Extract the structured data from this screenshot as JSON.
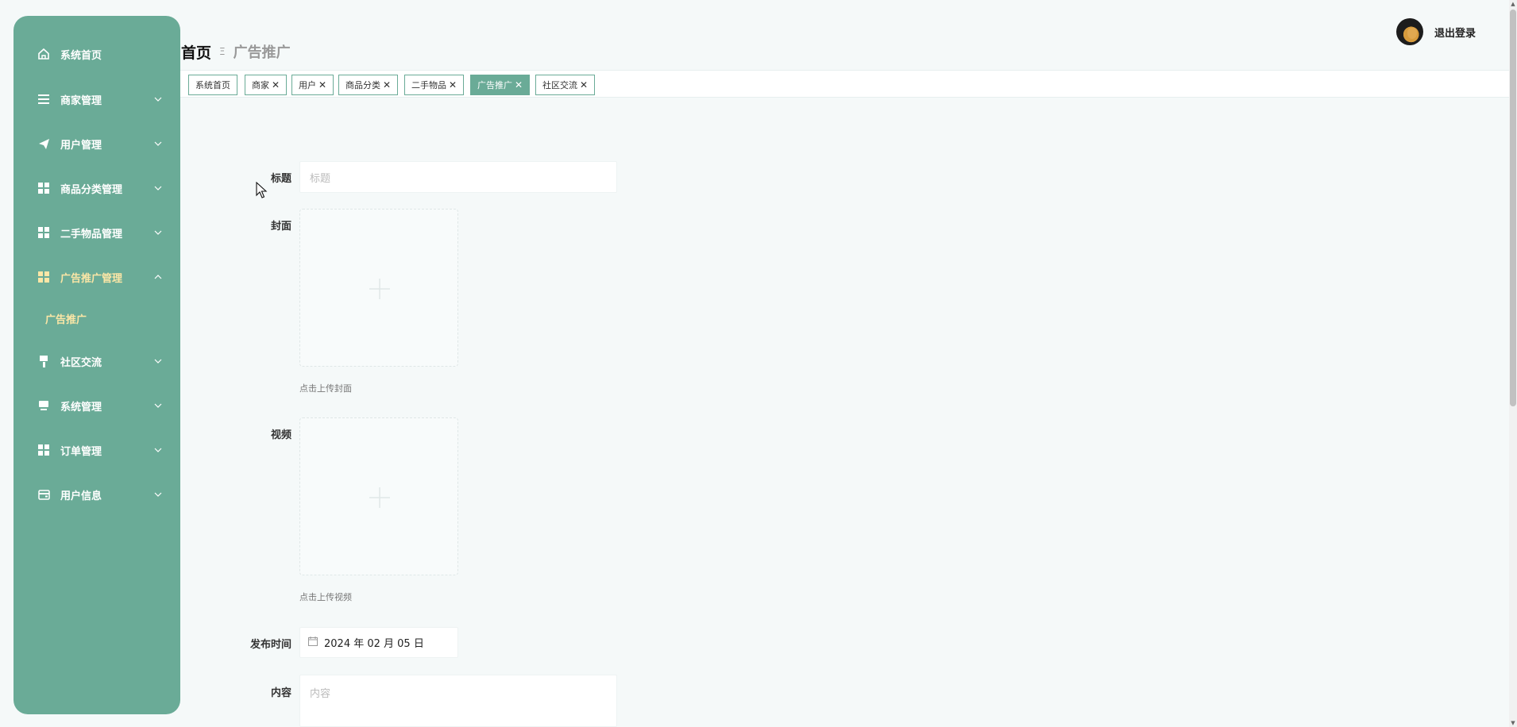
{
  "colors": {
    "accent": "#6aab97",
    "active_text": "#fbe6a6"
  },
  "sidebar": {
    "items": [
      {
        "label": "系统首页",
        "icon": "home-icon",
        "chevron": false
      },
      {
        "label": "商家管理",
        "icon": "list-icon",
        "chevron": "down"
      },
      {
        "label": "用户管理",
        "icon": "send-icon",
        "chevron": "down"
      },
      {
        "label": "商品分类管理",
        "icon": "grid-icon",
        "chevron": "down"
      },
      {
        "label": "二手物品管理",
        "icon": "grid-icon",
        "chevron": "down"
      },
      {
        "label": "广告推广管理",
        "icon": "grid-icon",
        "chevron": "up",
        "active": true
      },
      {
        "label": "社区交流",
        "icon": "brush-icon",
        "chevron": "down"
      },
      {
        "label": "系统管理",
        "icon": "monitor-icon",
        "chevron": "down"
      },
      {
        "label": "订单管理",
        "icon": "grid-icon",
        "chevron": "down"
      },
      {
        "label": "用户信息",
        "icon": "card-icon",
        "chevron": "down"
      }
    ],
    "submenu": {
      "label": "广告推广"
    }
  },
  "header": {
    "breadcrumb_home": "首页",
    "breadcrumb_separator": "Ξ",
    "breadcrumb_current": "广告推广",
    "logout_label": "退出登录"
  },
  "tabs": [
    {
      "label": "系统首页",
      "closable": false
    },
    {
      "label": "商家",
      "closable": true
    },
    {
      "label": "用户",
      "closable": true
    },
    {
      "label": "商品分类",
      "closable": true
    },
    {
      "label": "二手物品",
      "closable": true
    },
    {
      "label": "广告推广",
      "closable": true,
      "active": true
    },
    {
      "label": "社区交流",
      "closable": true
    }
  ],
  "form": {
    "title_label": "标题",
    "title_placeholder": "标题",
    "cover_label": "封面",
    "cover_hint": "点击上传封面",
    "video_label": "视频",
    "video_hint": "点击上传视频",
    "date_label": "发布时间",
    "date_value": "2024 年 02 月 05 日",
    "content_label": "内容",
    "content_placeholder": "内容"
  }
}
